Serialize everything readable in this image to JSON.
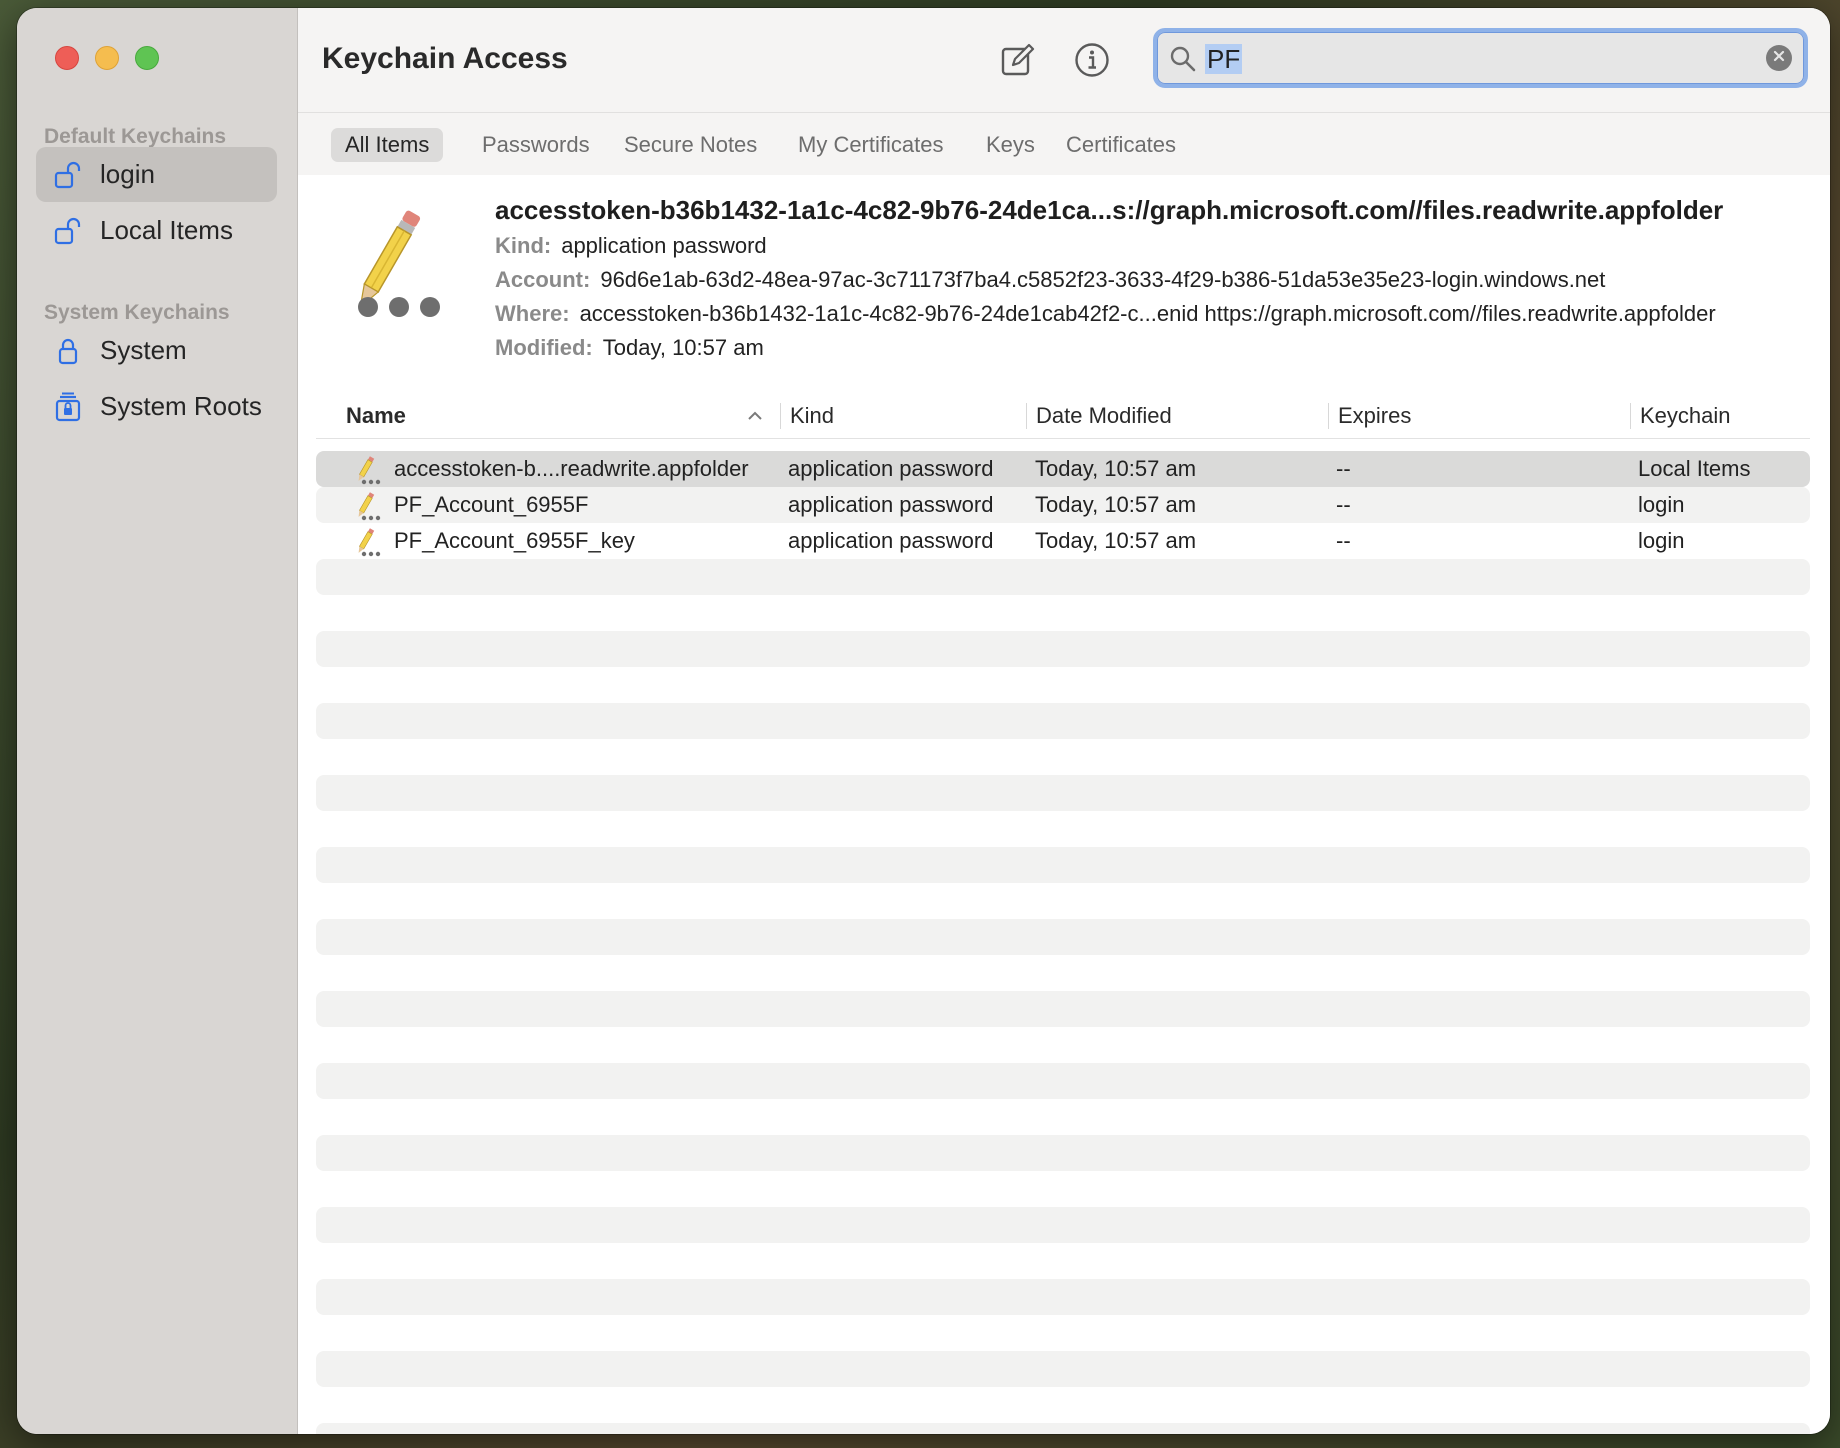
{
  "window": {
    "title": "Keychain Access"
  },
  "sidebar": {
    "default_header": "Default Keychains",
    "system_header": "System Keychains",
    "items": [
      {
        "label": "login",
        "icon": "unlocked-padlock-icon",
        "selected": true
      },
      {
        "label": "Local Items",
        "icon": "unlocked-padlock-icon",
        "selected": false
      },
      {
        "label": "System",
        "icon": "locked-padlock-icon",
        "selected": false
      },
      {
        "label": "System Roots",
        "icon": "locked-cabinet-icon",
        "selected": false
      }
    ]
  },
  "toolbar": {
    "compose_icon": "compose-icon",
    "info_icon": "info-icon"
  },
  "search": {
    "value": "PF",
    "placeholder": "Search"
  },
  "tabs": [
    {
      "label": "All Items",
      "active": true
    },
    {
      "label": "Passwords",
      "active": false
    },
    {
      "label": "Secure Notes",
      "active": false
    },
    {
      "label": "My Certificates",
      "active": false
    },
    {
      "label": "Keys",
      "active": false
    },
    {
      "label": "Certificates",
      "active": false
    }
  ],
  "detail": {
    "title": "accesstoken-b36b1432-1a1c-4c82-9b76-24de1ca...s://graph.microsoft.com//files.readwrite.appfolder",
    "kind_label": "Kind:",
    "kind_value": "application password",
    "account_label": "Account:",
    "account_value": "96d6e1ab-63d2-48ea-97ac-3c71173f7ba4.c5852f23-3633-4f29-b386-51da53e35e23-login.windows.net",
    "where_label": "Where:",
    "where_value": "accesstoken-b36b1432-1a1c-4c82-9b76-24de1cab42f2-c...enid https://graph.microsoft.com//files.readwrite.appfolder",
    "modified_label": "Modified:",
    "modified_value": "Today, 10:57 am"
  },
  "table": {
    "columns": [
      "Name",
      "Kind",
      "Date Modified",
      "Expires",
      "Keychain"
    ],
    "rows": [
      {
        "name": "accesstoken-b....readwrite.appfolder",
        "kind": "application password",
        "date": "Today, 10:57 am",
        "expires": "--",
        "keychain": "Local Items",
        "selected": true
      },
      {
        "name": "PF_Account_6955F",
        "kind": "application password",
        "date": "Today, 10:57 am",
        "expires": "--",
        "keychain": "login",
        "selected": false
      },
      {
        "name": "PF_Account_6955F_key",
        "kind": "application password",
        "date": "Today, 10:57 am",
        "expires": "--",
        "keychain": "login",
        "selected": false
      }
    ]
  },
  "colors": {
    "accent": "#2f6fe4",
    "search_focus": "#8fb2e8",
    "selection": "#b3cdf3"
  }
}
